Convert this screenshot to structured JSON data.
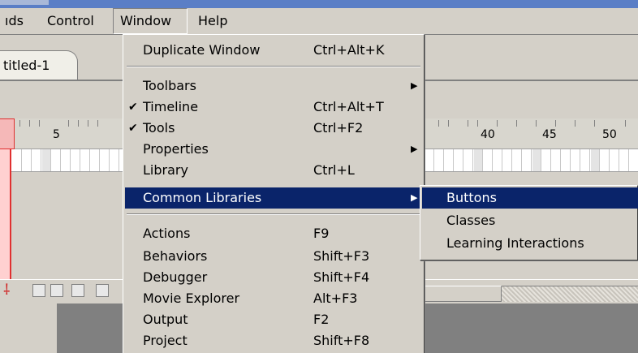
{
  "menubar": {
    "items": [
      {
        "label": "ıds"
      },
      {
        "label": "Control"
      },
      {
        "label": "Window"
      },
      {
        "label": "Help"
      }
    ]
  },
  "document": {
    "tab_label": "titled-1"
  },
  "timeline": {
    "ruler_labels": [
      "5",
      "40",
      "45",
      "50"
    ]
  },
  "window_menu": {
    "items": [
      {
        "label": "Duplicate Window",
        "shortcut": "Ctrl+Alt+K"
      },
      {
        "label": "Toolbars",
        "shortcut": ""
      },
      {
        "label": "Timeline",
        "shortcut": "Ctrl+Alt+T"
      },
      {
        "label": "Tools",
        "shortcut": "Ctrl+F2"
      },
      {
        "label": "Properties",
        "shortcut": ""
      },
      {
        "label": "Library",
        "shortcut": "Ctrl+L"
      },
      {
        "label": "Common Libraries",
        "shortcut": ""
      },
      {
        "label": "Actions",
        "shortcut": "F9"
      },
      {
        "label": "Behaviors",
        "shortcut": "Shift+F3"
      },
      {
        "label": "Debugger",
        "shortcut": "Shift+F4"
      },
      {
        "label": "Movie Explorer",
        "shortcut": "Alt+F3"
      },
      {
        "label": "Output",
        "shortcut": "F2"
      },
      {
        "label": "Project",
        "shortcut": "Shift+F8"
      }
    ]
  },
  "common_libraries_submenu": {
    "items": [
      {
        "label": "Buttons"
      },
      {
        "label": "Classes"
      },
      {
        "label": "Learning Interactions"
      }
    ]
  },
  "colors": {
    "menu_highlight": "#0a246a",
    "chrome": "#d4d0c8",
    "playhead": "#e03030"
  }
}
